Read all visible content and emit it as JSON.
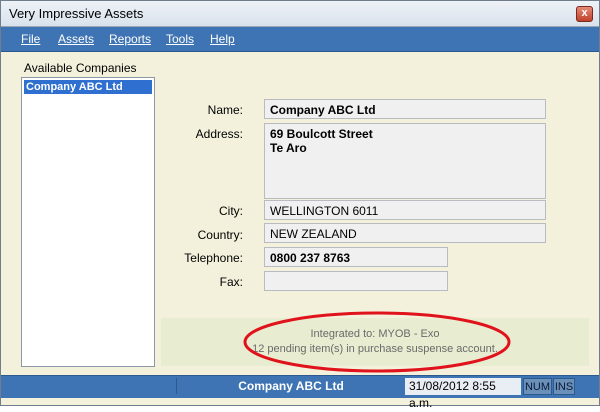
{
  "window": {
    "title": "Very Impressive Assets",
    "close_glyph": "x"
  },
  "menu": [
    "File",
    "Assets",
    "Reports",
    "Tools",
    "Help"
  ],
  "companies": {
    "label": "Available Companies",
    "items": [
      "Company ABC Ltd"
    ],
    "selected_index": 0
  },
  "details": {
    "name_label": "Name:",
    "name": "Company ABC Ltd",
    "address_label": "Address:",
    "address_line1": "69 Boulcott Street",
    "address_line2": "Te Aro",
    "city_label": "City:",
    "city": "WELLINGTON 6011",
    "country_label": "Country:",
    "country": "NEW ZEALAND",
    "telephone_label": "Telephone:",
    "telephone": "0800 237 8763",
    "fax_label": "Fax:",
    "fax": ""
  },
  "notice": {
    "line1": "Integrated to: MYOB - Exo",
    "line2": "12 pending item(s) in purchase suspense account.",
    "highlight_color": "#e0121b"
  },
  "status": {
    "company": "Company ABC Ltd",
    "date_time": "31/08/2012  8:55 a.m.",
    "num": "NUM",
    "ins": "INS"
  },
  "colors": {
    "accent": "#3e74b3",
    "selection": "#2f6fd0",
    "background": "#f3f1dc"
  }
}
